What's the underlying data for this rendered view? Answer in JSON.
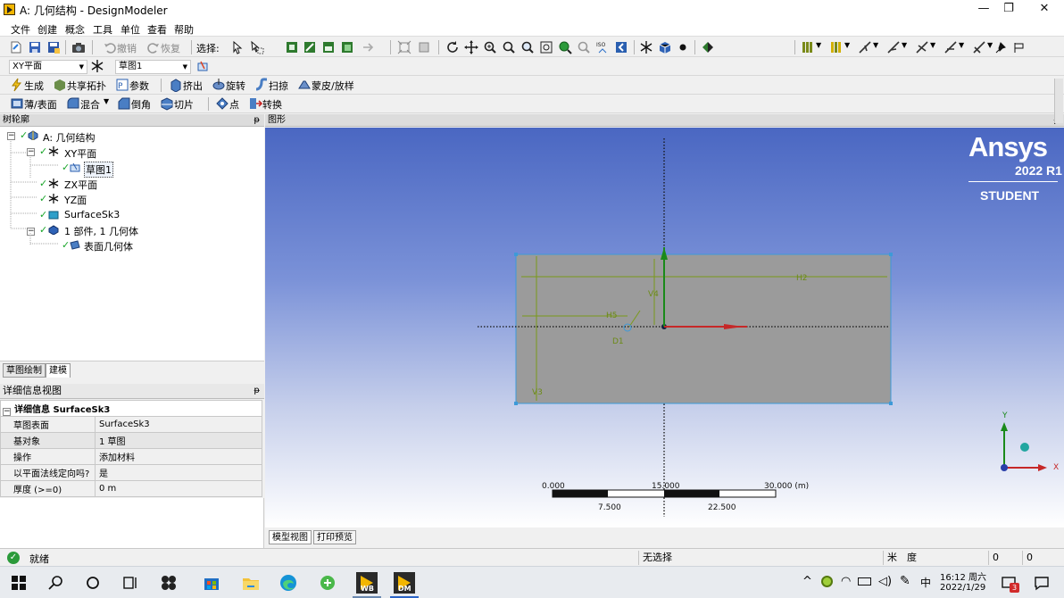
{
  "window": {
    "title": "A: 几何结构 - DesignModeler",
    "minimize": "—",
    "restore": "❐",
    "close": "✕"
  },
  "menu": [
    "文件",
    "创建",
    "概念",
    "工具",
    "单位",
    "查看",
    "帮助"
  ],
  "toolbar1": {
    "undo": "撤销",
    "redo": "恢复",
    "select": "选择:"
  },
  "toolbar2": {
    "plane_select": "XY平面",
    "sketch_select": "草图1"
  },
  "toolbar3": {
    "generate": "生成",
    "share_topology": "共享拓扑",
    "parameters": "参数",
    "extrude": "挤出",
    "revolve": "旋转",
    "sweep": "扫掠",
    "skin_loft": "蒙皮/放样"
  },
  "toolbar4": {
    "thin_surface": "薄/表面",
    "blend": "混合",
    "chamfer": "倒角",
    "slice": "切片",
    "point": "点",
    "convert": "转换"
  },
  "tree": {
    "header": "树轮廓",
    "pin": "ᵽ",
    "nodes": [
      "A: 几何结构",
      "XY平面",
      "草图1",
      "ZX平面",
      "YZ面",
      "SurfaceSk3",
      "1 部件, 1 几何体",
      "表面几何体"
    ]
  },
  "tree_tabs": [
    "草图绘制",
    "建模"
  ],
  "details": {
    "header": "详细信息视图",
    "pin": "ᵽ",
    "section": "详细信息 SurfaceSk3",
    "rows": [
      {
        "k": "草图表面",
        "v": "SurfaceSk3"
      },
      {
        "k": "基对象",
        "v": "1 草图"
      },
      {
        "k": "操作",
        "v": "添加材料"
      },
      {
        "k": "以平面法线定向吗?",
        "v": "是"
      },
      {
        "k": "厚度 (>=0)",
        "v": "0 m"
      }
    ]
  },
  "graphics": {
    "header": "图形",
    "logo": {
      "brand": "Ansys",
      "version": "2022 R1",
      "edition": "STUDENT"
    },
    "dims": {
      "h2": "H2",
      "v4": "V4",
      "h5": "H5",
      "d1": "D1",
      "v3": "V3"
    },
    "scale": {
      "top": [
        "0.000",
        "15.000",
        "30.000 (m)"
      ],
      "bottom": [
        "7.500",
        "22.500"
      ]
    },
    "axes": {
      "x": "X",
      "y": "Y"
    },
    "tabs": [
      "模型视图",
      "打印预览"
    ],
    "colors": {
      "shape": "#9b9b9b",
      "outline": "#3d9ad8",
      "dimension": "#7a9a1a"
    }
  },
  "status": {
    "ready": "就绪",
    "selection": "无选择",
    "unit_m": "米",
    "unit_deg": "度",
    "f1": "0",
    "f2": "0"
  },
  "taskbar": {
    "time": "16:12 周六",
    "date": "2022/1/29",
    "ime": "中",
    "notify_badge": "3"
  }
}
